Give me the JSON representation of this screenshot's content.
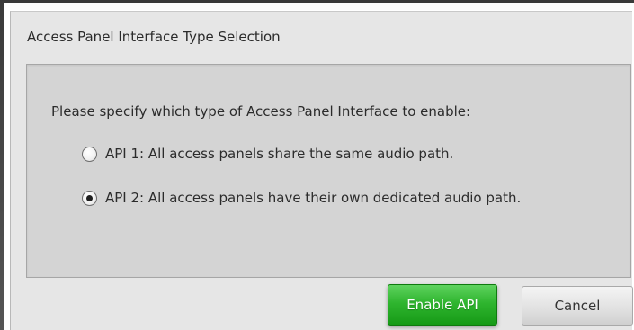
{
  "dialog": {
    "title": "Access Panel Interface Type Selection",
    "prompt": "Please specify which type of Access Panel Interface to enable:",
    "options": [
      {
        "label": "API 1: All access panels share the same audio path.",
        "selected": false
      },
      {
        "label": "API 2: All access panels have their own dedicated audio path.",
        "selected": true
      }
    ],
    "buttons": {
      "enable_label": "Enable API",
      "cancel_label": "Cancel"
    }
  },
  "colors": {
    "dialog_bg": "#e6e6e6",
    "panel_bg": "#d4d4d4",
    "primary_button": "#2fb52f",
    "text": "#2b2b2b"
  }
}
